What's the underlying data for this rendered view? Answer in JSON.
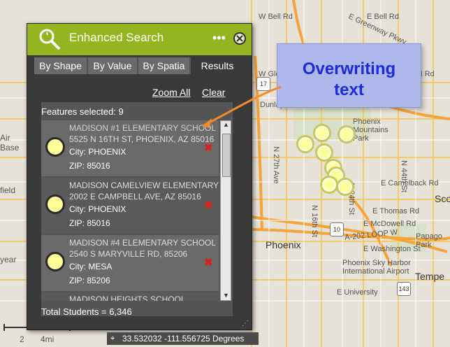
{
  "map": {
    "labels": [
      {
        "id": "w-bell-rd",
        "text": "W Bell Rd"
      },
      {
        "id": "e-bell-rd",
        "text": "E Bell Rd"
      },
      {
        "id": "e-greenway-pkwy",
        "text": "E Greenway Pkwy"
      },
      {
        "id": "e-thunderbird-rd",
        "text": "E Thunderbird Rd"
      },
      {
        "id": "dunlap-ave",
        "text": "Dunlap Ave"
      },
      {
        "id": "w-glendale-ave",
        "text": "W Glendale Ave"
      },
      {
        "id": "n-27th-ave",
        "text": "N 27th Ave"
      },
      {
        "id": "n-16th-st",
        "text": "N 16th St"
      },
      {
        "id": "n-24th-st",
        "text": "N 24th St"
      },
      {
        "id": "n-44th-st",
        "text": "N 44th St"
      },
      {
        "id": "e-camelback-rd",
        "text": "E Camelback Rd"
      },
      {
        "id": "e-thomas-rd",
        "text": "E Thomas Rd"
      },
      {
        "id": "e-mcdowell",
        "text": "E McDowell Rd"
      },
      {
        "id": "a202-loop",
        "text": "A-202 LOOP W"
      },
      {
        "id": "e-washington",
        "text": "E Washington St"
      },
      {
        "id": "phoenix-sky-harbor",
        "text": "Phoenix Sky Harbor International Airport"
      },
      {
        "id": "e-university",
        "text": "E University"
      },
      {
        "id": "papago-park",
        "text": "Papago Park"
      },
      {
        "id": "phoenix-mountains",
        "text": "Phoenix Mountains Park"
      },
      {
        "id": "air-base",
        "text": "Air Base"
      },
      {
        "id": "field",
        "text": "field"
      },
      {
        "id": "year",
        "text": "year"
      },
      {
        "id": "sco",
        "text": "Sco"
      },
      {
        "id": "scale-mi",
        "text": "4mi"
      },
      {
        "id": "scale-2",
        "text": "2"
      }
    ],
    "cities": [
      {
        "id": "phoenix",
        "text": "Phoenix"
      },
      {
        "id": "tempe",
        "text": "Tempe"
      }
    ],
    "highways": [
      {
        "id": "hwy-17",
        "text": "17"
      },
      {
        "id": "hwy-10",
        "text": "10"
      },
      {
        "id": "hwy-143",
        "text": "143"
      }
    ]
  },
  "widget": {
    "title": "Enhanced Search",
    "more_icon": "more-icon",
    "close_icon": "close-icon",
    "tabs": [
      "By Shape",
      "By Value",
      "By Spatia",
      "Results"
    ],
    "active_tab": "Results",
    "zoom_all": "Zoom All",
    "clear": "Clear",
    "features_selected": "Features selected: 9",
    "results": [
      {
        "name_a": "MADISON #1 ELEMENTARY SCHOOL",
        "name_b": "5525 N 16TH ST, PHOENIX, AZ 85016",
        "city": "City: PHOENIX",
        "zip": "ZIP: 85016"
      },
      {
        "name_a": "MADISON CAMELVIEW ELEMENTARY",
        "name_b": "2002 E CAMPBELL AVE, AZ 85016",
        "city": "City: PHOENIX",
        "zip": "ZIP: 85016"
      },
      {
        "name_a": "MADISON #4 ELEMENTARY SCHOOL",
        "name_b": "2540 S MARYVILLE RD, 85206",
        "city": "City: MESA",
        "zip": "ZIP: 85206"
      },
      {
        "name_a": "MADISON HEIGHTS SCHOOL",
        "name_b": "",
        "city": "",
        "zip": ""
      }
    ],
    "total": "Total Students = 6,346"
  },
  "callout": {
    "line1": "Overwriting",
    "line2": "text"
  },
  "coordinates": "33.532032 -111.556725 Degrees"
}
